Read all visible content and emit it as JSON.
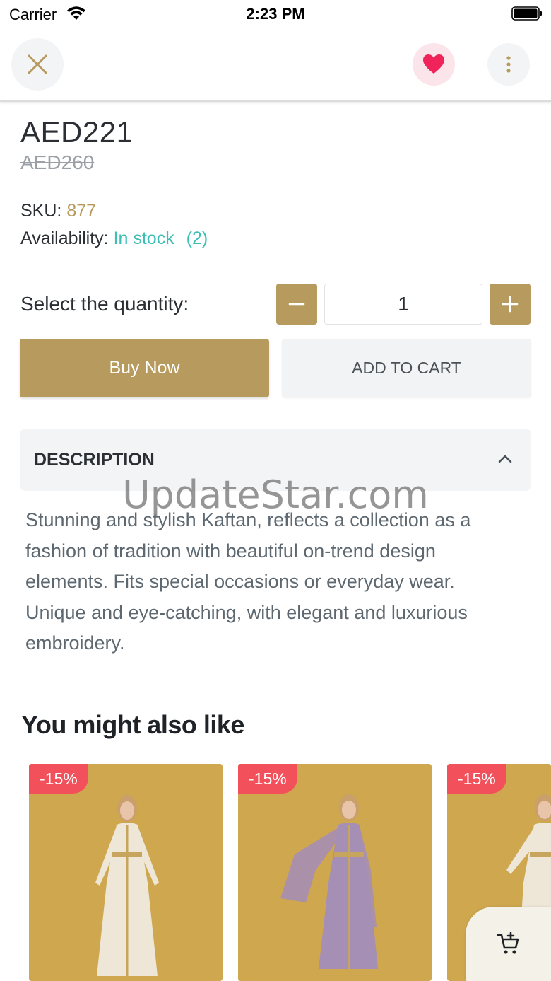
{
  "status_bar": {
    "carrier": "Carrier",
    "time": "2:23 PM"
  },
  "nav": {
    "close_icon": "close-icon",
    "favorite_icon": "heart-icon",
    "more_icon": "more-vertical-icon",
    "favorite_color": "#f0245a"
  },
  "product": {
    "price": "AED221",
    "old_price": "AED260",
    "sku_label": "SKU:",
    "sku_value": "877",
    "availability_label": "Availability:",
    "availability_value": "In stock",
    "availability_count": "(2)"
  },
  "quantity": {
    "label": "Select the quantity:",
    "value": "1"
  },
  "actions": {
    "buy_now": "Buy Now",
    "add_to_cart": "ADD TO CART"
  },
  "description": {
    "title": "DESCRIPTION",
    "body": "Stunning and stylish Kaftan, reflects a collection as a fashion of tradition with beautiful on-trend design elements. Fits special occasions or everyday wear. Unique and eye-catching, with elegant and luxurious embroidery."
  },
  "watermark": "UpdateStar.com",
  "recommendations": {
    "title": "You might also like",
    "items": [
      {
        "discount": "-15%",
        "dress_color": "#eee6d6"
      },
      {
        "discount": "-15%",
        "dress_color": "#a58fb4"
      },
      {
        "discount": "-15%",
        "dress_color": "#eee6d6"
      }
    ]
  },
  "colors": {
    "accent": "#b79a5e",
    "in_stock": "#3cbfb4",
    "badge": "#f2505a",
    "card_background": "#cfa74e"
  }
}
